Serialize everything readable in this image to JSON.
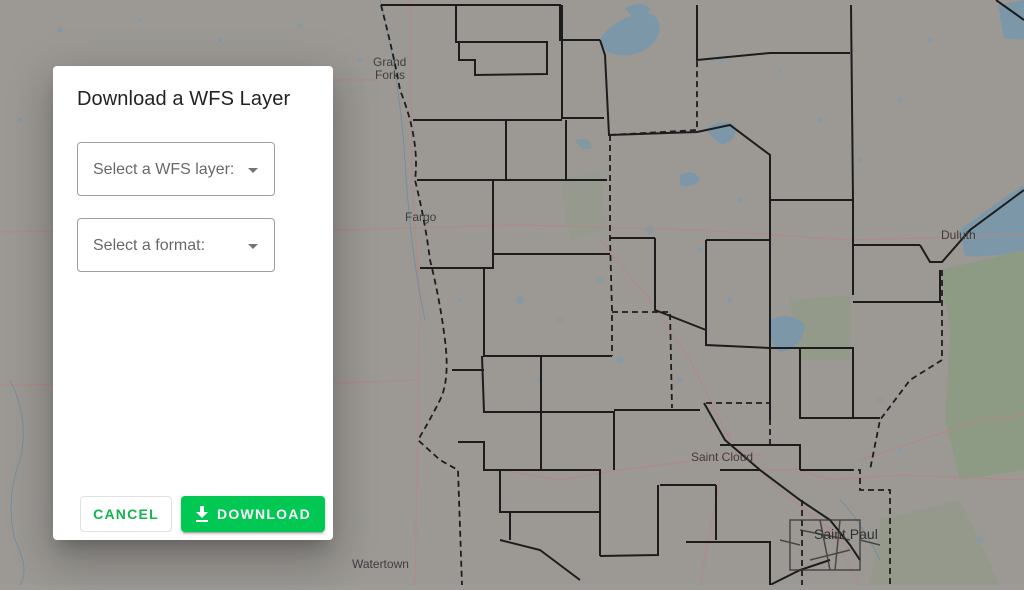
{
  "map": {
    "labels": {
      "grand_forks_1": "Grand",
      "grand_forks_2": "Forks",
      "fargo": "Fargo",
      "duluth": "Duluth",
      "saint_cloud": "Saint Cloud",
      "saint_paul": "Saint Paul",
      "watertown": "Watertown"
    }
  },
  "dialog": {
    "title": "Download a WFS Layer",
    "layer_select": {
      "placeholder": "Select a WFS layer:"
    },
    "format_select": {
      "placeholder": "Select a format:"
    },
    "cancel_label": "CANCEL",
    "download_label": "DOWNLOAD",
    "download_icon": "download-icon"
  },
  "colors": {
    "accent": "#00c853",
    "accent_text": "#12b54e",
    "scrim_map": "#9c9b97"
  }
}
